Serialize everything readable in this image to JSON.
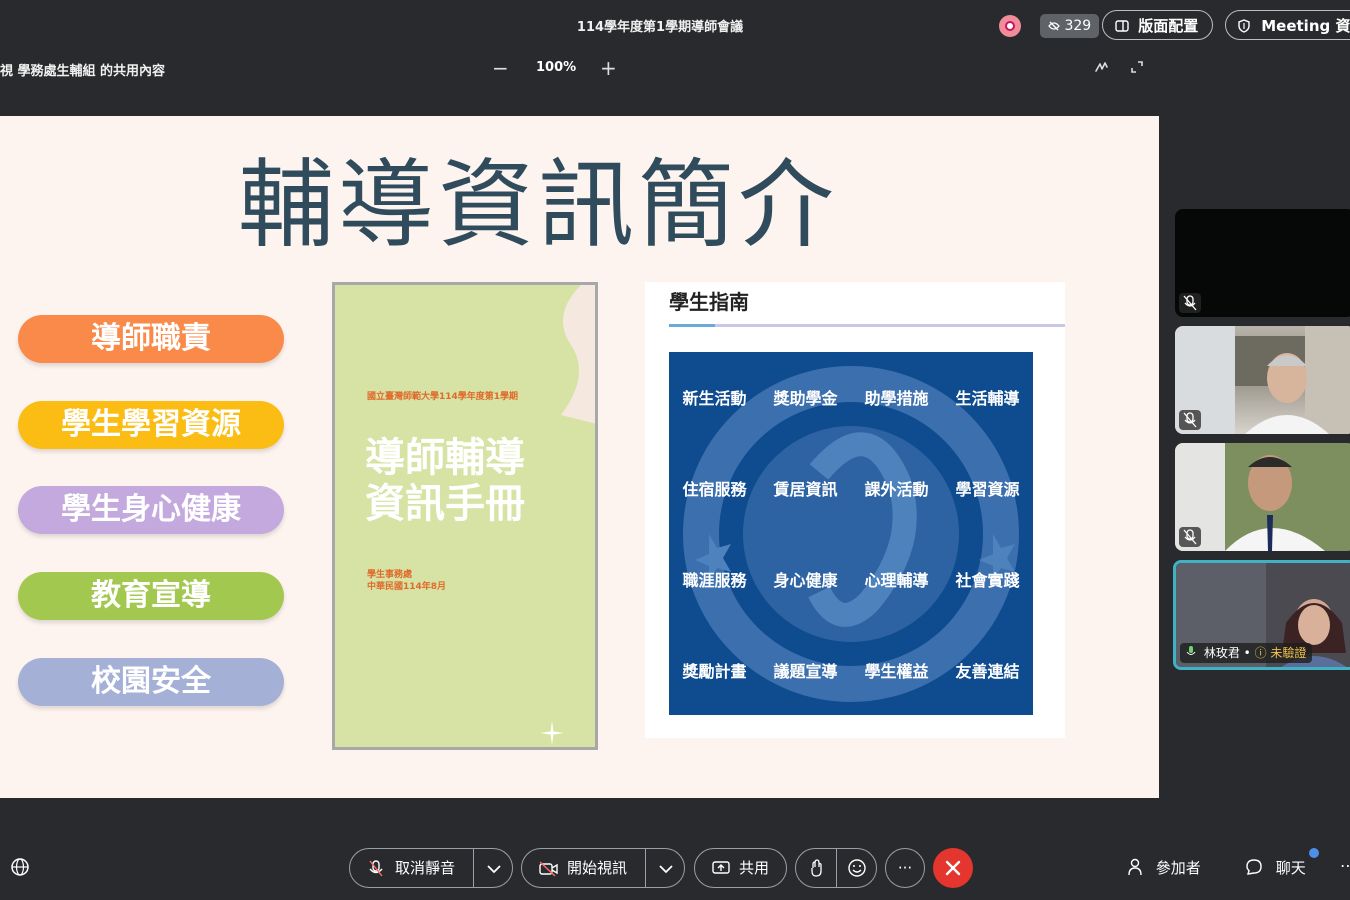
{
  "meeting": {
    "title": "114學年度第1學期導師會議",
    "viewer_count": "329",
    "layout_label": "版面配置",
    "meeting_info_label": "Meeting 資訊"
  },
  "share_bar": {
    "caption": "視 學務處生輔組 的共用內容",
    "zoom_minus": "−",
    "zoom_level": "100%",
    "zoom_plus": "+"
  },
  "slide": {
    "title": "輔導資訊簡介",
    "menu": [
      {
        "label": "導師職責",
        "color": "#f98a4a"
      },
      {
        "label": "學生學習資源",
        "color": "#fbbd13"
      },
      {
        "label": "學生身心健康",
        "color": "#c3a9dd"
      },
      {
        "label": "教育宣導",
        "color": "#a3c850"
      },
      {
        "label": "校園安全",
        "color": "#a4b0d6"
      }
    ],
    "handbook": {
      "header": "國立臺灣師範大學114學年度第1學期",
      "title_line1": "導師輔導",
      "title_line2": "資訊手冊",
      "office": "學生事務處",
      "date": "中華民國114年8月"
    },
    "guide": {
      "title": "學生指南",
      "items": [
        "新生活動",
        "獎助學金",
        "助學措施",
        "生活輔導",
        "住宿服務",
        "賃居資訊",
        "課外活動",
        "學習資源",
        "職涯服務",
        "身心健康",
        "心理輔導",
        "社會實踐",
        "獎勵計畫",
        "議題宣導",
        "學生權益",
        "友善連結"
      ]
    }
  },
  "participants": [
    {
      "name": ""
    },
    {
      "name": ""
    },
    {
      "name": ""
    },
    {
      "name": "林玫君",
      "status": "未驗證"
    }
  ],
  "toolbar": {
    "unmute_label": "取消靜音",
    "start_video_label": "開始視訊",
    "share_label": "共用",
    "more_label": "···",
    "participants_label": "參加者",
    "chat_label": "聊天"
  }
}
